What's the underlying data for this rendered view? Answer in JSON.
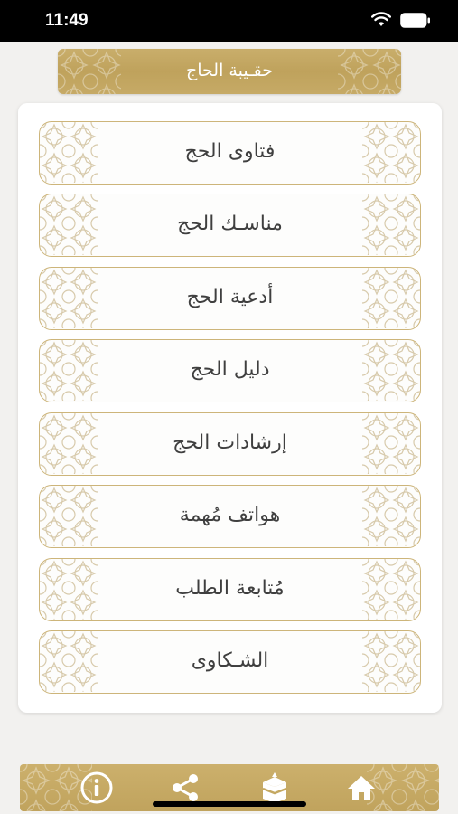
{
  "status_bar": {
    "time": "11:49"
  },
  "header": {
    "title": "حقـيبة الحاج"
  },
  "menu": {
    "items": [
      {
        "label": "فتاوى الحج"
      },
      {
        "label": "مناسـك الحج"
      },
      {
        "label": "أدعية الحج"
      },
      {
        "label": "دليل الحج"
      },
      {
        "label": "إرشادات الحج"
      },
      {
        "label": "هواتف مُهمة"
      },
      {
        "label": "مُتابعة الطلب"
      },
      {
        "label": "الشـكاوى"
      }
    ]
  },
  "tab_bar": {
    "icons": [
      "info-icon",
      "share-icon",
      "kaaba-icon",
      "home-icon"
    ]
  },
  "colors": {
    "gold": "#c4a862",
    "item_border": "#cdb57a",
    "text": "#3f3f3f",
    "background": "#f2f1ef"
  }
}
